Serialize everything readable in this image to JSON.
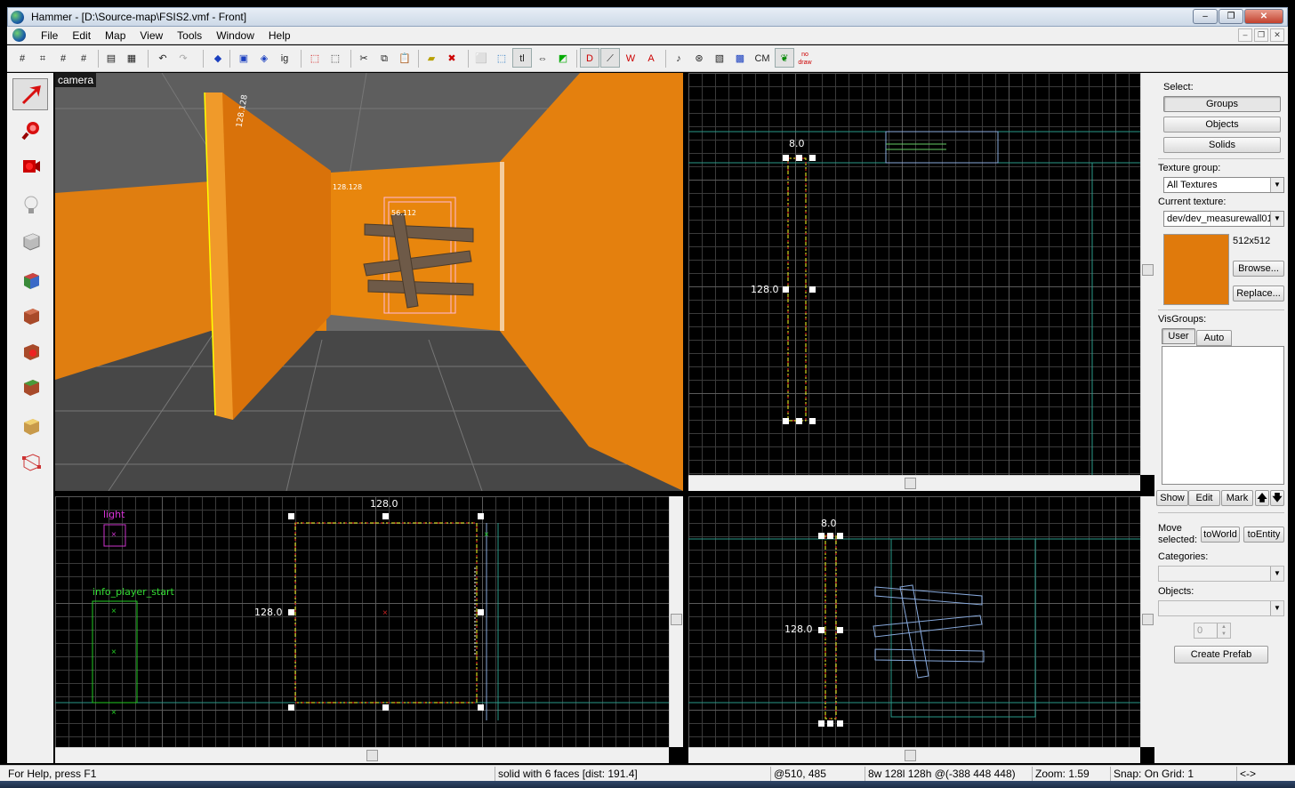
{
  "window": {
    "title": "Hammer - [D:\\Source-map\\FSIS2.vmf - Front]",
    "minimize": "–",
    "maximize": "❐",
    "close": "✕"
  },
  "menu": {
    "items": [
      "File",
      "Edit",
      "Map",
      "View",
      "Tools",
      "Window",
      "Help"
    ],
    "mdi_minimize": "–",
    "mdi_restore": "❐",
    "mdi_close": "✕"
  },
  "toolbar": {
    "ignore_groups_label": "ig",
    "texture_lock_label": "tl",
    "cordon_label": "CM",
    "nodraw_label": "no draw"
  },
  "viewports": {
    "camera": {
      "label": "camera",
      "wall_text_1": "128.128",
      "wall_text_2": "128.128",
      "door_text": "56.112"
    },
    "top": {
      "width_label": "8.0",
      "height_label": "128.0"
    },
    "front": {
      "width_label": "128.0",
      "height_label": "128.0",
      "light_label": "light",
      "player_label": "info_player_start"
    },
    "side": {
      "width_label": "8.0",
      "height_label": "128.0"
    }
  },
  "right_panel": {
    "select_label": "Select:",
    "groups_button": "Groups",
    "objects_button": "Objects",
    "solids_button": "Solids",
    "texture_group_label": "Texture group:",
    "texture_group_value": "All Textures",
    "current_texture_label": "Current texture:",
    "current_texture_value": "dev/dev_measurewall01",
    "texture_size": "512x512",
    "browse_button": "Browse...",
    "replace_button": "Replace...",
    "visgroups_label": "VisGroups:",
    "tab_user": "User",
    "tab_auto": "Auto",
    "show_button": "Show",
    "edit_button": "Edit",
    "mark_button": "Mark",
    "move_selected_label": "Move selected:",
    "to_world_button": "toWorld",
    "to_entity_button": "toEntity",
    "categories_label": "Categories:",
    "objects_label": "Objects:",
    "objects_count": "0",
    "create_prefab_button": "Create Prefab",
    "texture_color": "#e07a0c"
  },
  "status": {
    "help": "For Help, press F1",
    "selection": "solid with 6 faces   [dist: 191.4]",
    "cursor": "@510, 485",
    "size": "8w 128l 128h @(-388 448 448)",
    "zoom": "Zoom: 1.59",
    "snap": "Snap: On Grid: 1",
    "extra": "<->"
  }
}
